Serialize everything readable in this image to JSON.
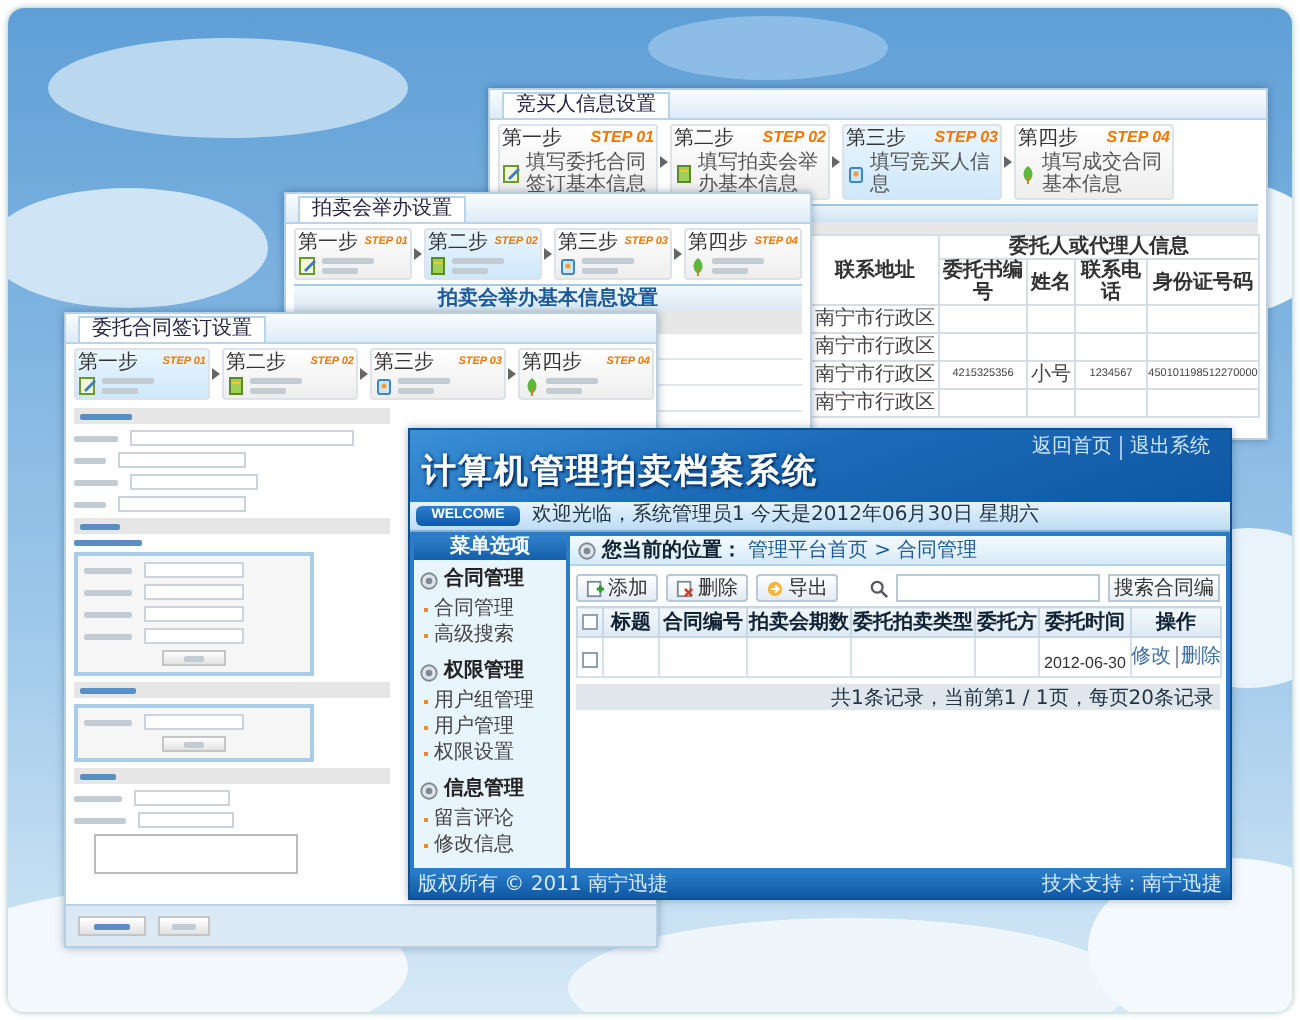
{
  "bidder_window": {
    "tab": "竞买人信息设置",
    "steps": [
      {
        "label": "第一步",
        "step": "STEP 01",
        "description": "填写委托合同签订基本信息",
        "selected": false
      },
      {
        "label": "第二步",
        "step": "STEP 02",
        "description": "填写拍卖会举办基本信息",
        "selected": false
      },
      {
        "label": "第三步",
        "step": "STEP 03",
        "description": "填写竞买人信息",
        "selected": true
      },
      {
        "label": "第四步",
        "step": "STEP 04",
        "description": "填写成交合同基本信息",
        "selected": false
      }
    ],
    "table": {
      "address_header": "联系地址",
      "group_header": "委托人或代理人信息",
      "group_columns": [
        "委托书编号",
        "姓名",
        "联系电话",
        "身份证号码"
      ],
      "rows": [
        [
          "南宁市行政区"
        ],
        [
          "南宁市行政区"
        ],
        [
          "南宁市行政区",
          "4215325356",
          "小号",
          "1234567",
          "450101198512270000"
        ],
        [
          "南宁市行政区"
        ]
      ]
    }
  },
  "auction_window": {
    "tab": "拍卖会举办设置",
    "steps": [
      {
        "label": "第一步",
        "step": "STEP 01",
        "selected": false
      },
      {
        "label": "第二步",
        "step": "STEP 02",
        "selected": true
      },
      {
        "label": "第三步",
        "step": "STEP 03",
        "selected": false
      },
      {
        "label": "第四步",
        "step": "STEP 04",
        "selected": false
      }
    ],
    "section_title": "拍卖会举办基本信息设置"
  },
  "contract_window": {
    "tab": "委托合同签订设置",
    "steps": [
      {
        "label": "第一步",
        "step": "STEP 01",
        "selected": true
      },
      {
        "label": "第二步",
        "step": "STEP 02",
        "selected": false
      },
      {
        "label": "第三步",
        "step": "STEP 03",
        "selected": false
      },
      {
        "label": "第四步",
        "step": "STEP 04",
        "selected": false
      }
    ]
  },
  "main_window": {
    "title": "计算机管理拍卖档案系统",
    "top_links": [
      "返回首页",
      "退出系统"
    ],
    "welcome_badge": "WELCOME",
    "welcome_text": "欢迎光临，系统管理员1 今天是2012年06月30日 星期六",
    "menu_title": "菜单选项",
    "menu": [
      {
        "label": "合同管理",
        "children": [
          {
            "label": "合同管理"
          },
          {
            "label": "高级搜索"
          }
        ]
      },
      {
        "label": "权限管理",
        "children": [
          {
            "label": "用户组管理"
          },
          {
            "label": "用户管理"
          },
          {
            "label": "权限设置"
          }
        ]
      },
      {
        "label": "信息管理",
        "children": [
          {
            "label": "留言评论"
          },
          {
            "label": "修改信息"
          }
        ]
      }
    ],
    "breadcrumb_label": "您当前的位置：",
    "breadcrumb": "管理平台首页 > 合同管理",
    "toolbar": [
      "添加",
      "删除",
      "导出"
    ],
    "search_button": "搜索合同编",
    "table": {
      "all_checked": false,
      "columns": [
        "标题",
        "合同编号",
        "拍卖会期数",
        "委托拍卖类型",
        "委托方",
        "委托时间",
        "操作"
      ],
      "rows": [
        {
          "checked": false,
          "date": "2012-06-30",
          "actions": [
            "修改",
            "删除"
          ]
        }
      ]
    },
    "pagination": "共1条记录，当前第1 / 1页，每页20条记录",
    "footer_left": "版权所有 © 2011 南宁迅捷",
    "footer_right": "技术支持：南宁迅捷"
  }
}
